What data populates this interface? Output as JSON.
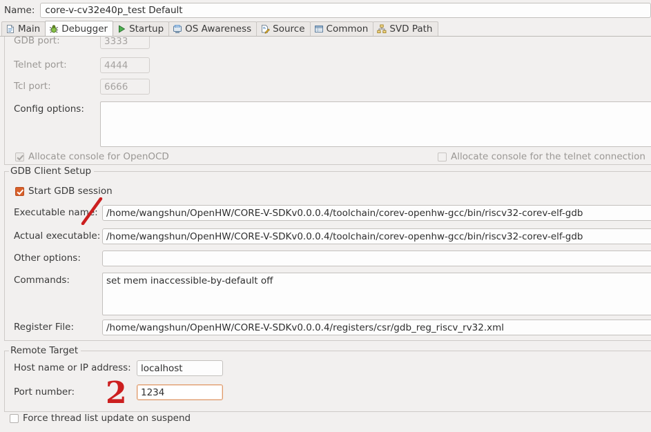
{
  "name_row": {
    "label": "Name:",
    "value": "core-v-cv32e40p_test Default"
  },
  "tabs": [
    {
      "label": "Main",
      "icon": "document-icon",
      "active": false
    },
    {
      "label": "Debugger",
      "icon": "bug-icon",
      "active": true
    },
    {
      "label": "Startup",
      "icon": "play-icon",
      "active": false
    },
    {
      "label": "OS Awareness",
      "icon": "os-icon",
      "active": false
    },
    {
      "label": "Source",
      "icon": "source-icon",
      "active": false
    },
    {
      "label": "Common",
      "icon": "table-icon",
      "active": false
    },
    {
      "label": "SVD Path",
      "icon": "hierarchy-icon",
      "active": false
    }
  ],
  "server": {
    "gdb_port_label": "GDB port:",
    "gdb_port_value": "3333",
    "telnet_port_label": "Telnet port:",
    "telnet_port_value": "4444",
    "tcl_port_label": "Tcl port:",
    "tcl_port_value": "6666",
    "config_options_label": "Config options:",
    "config_options_value": "",
    "allocate_openocd_label": "Allocate console for OpenOCD",
    "allocate_telnet_label": "Allocate console for the telnet connection"
  },
  "gdb_client": {
    "group_title": "GDB Client Setup",
    "start_gdb_label": "Start GDB session",
    "executable_name_label": "Executable name:",
    "executable_name_value": "/home/wangshun/OpenHW/CORE-V-SDKv0.0.0.4/toolchain/corev-openhw-gcc/bin/riscv32-corev-elf-gdb",
    "actual_executable_label": "Actual executable:",
    "actual_executable_value": "/home/wangshun/OpenHW/CORE-V-SDKv0.0.0.4/toolchain/corev-openhw-gcc/bin/riscv32-corev-elf-gdb",
    "other_options_label": "Other options:",
    "other_options_value": "",
    "commands_label": "Commands:",
    "commands_value": "set mem inaccessible-by-default off",
    "register_file_label": "Register File:",
    "register_file_value": "/home/wangshun/OpenHW/CORE-V-SDKv0.0.0.4/registers/csr/gdb_reg_riscv_rv32.xml"
  },
  "remote_target": {
    "group_title": "Remote Target",
    "host_label": "Host name or IP address:",
    "host_value": "localhost",
    "port_label": "Port number:",
    "port_value": "1234"
  },
  "footer": {
    "force_thread_label": "Force thread list update on suspend"
  },
  "annotations": {
    "mark_one": "/",
    "mark_two": "2"
  },
  "colors": {
    "background": "#f2f0ef",
    "accent_checkbox": "#d8602a",
    "annotation_red": "#cc1f1f",
    "focus_border": "#e09a6a"
  }
}
